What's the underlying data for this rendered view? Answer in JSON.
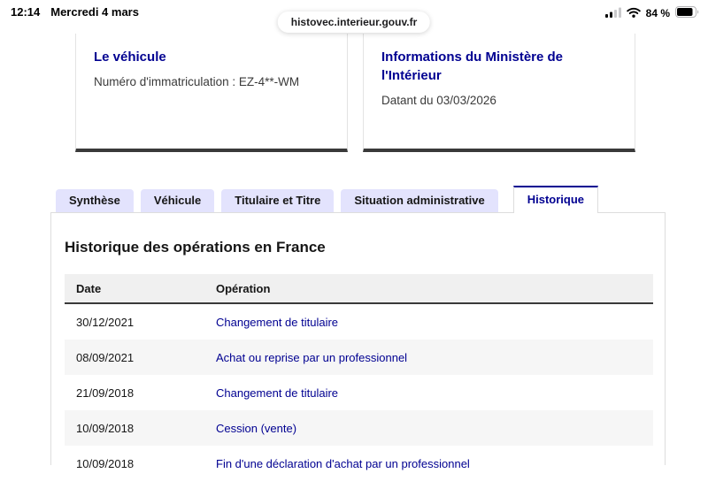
{
  "status_bar": {
    "time": "12:14",
    "date": "Mercredi 4 mars",
    "battery_percent": "84 %",
    "url": "histovec.interieur.gouv.fr",
    "icons": [
      "cellular-signal-icon",
      "wifi-icon",
      "battery-icon"
    ]
  },
  "cards": [
    {
      "title": "Le véhicule",
      "subtitle": "Numéro d'immatriculation : EZ-4**-WM"
    },
    {
      "title": "Informations du Ministère de l'Intérieur",
      "subtitle": "Datant du 03/03/2026"
    }
  ],
  "tabs": [
    {
      "label": "Synthèse",
      "active": false
    },
    {
      "label": "Véhicule",
      "active": false
    },
    {
      "label": "Titulaire et Titre",
      "active": false
    },
    {
      "label": "Situation administrative",
      "active": false
    },
    {
      "label": "Historique",
      "active": true
    }
  ],
  "history": {
    "title": "Historique des opérations en France",
    "table": {
      "columns": [
        "Date",
        "Opération"
      ],
      "rows": [
        {
          "date": "30/12/2021",
          "operation": "Changement de titulaire"
        },
        {
          "date": "08/09/2021",
          "operation": "Achat ou reprise par un professionnel"
        },
        {
          "date": "21/09/2018",
          "operation": "Changement de titulaire"
        },
        {
          "date": "10/09/2018",
          "operation": "Cession (vente)"
        },
        {
          "date": "10/09/2018",
          "operation": "Fin d'une déclaration d'achat par un professionnel"
        }
      ]
    }
  },
  "colors": {
    "accent_blue": "#000091",
    "tab_inactive_bg": "#e3e3fd",
    "dark_border": "#3a3a3a",
    "row_stripe": "#f6f6f6"
  }
}
